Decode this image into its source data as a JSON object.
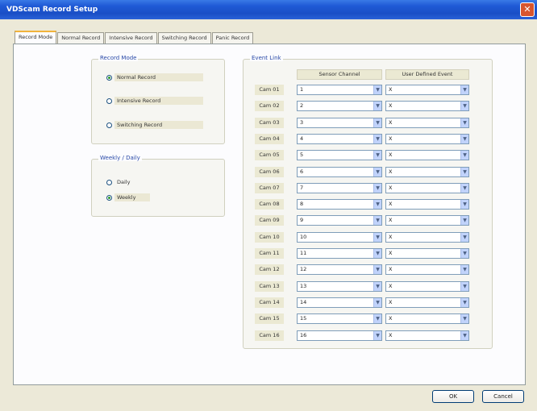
{
  "window": {
    "title": "VDScam Record Setup",
    "close_glyph": "✕"
  },
  "tabs": [
    {
      "label": "Record Mode",
      "active": true
    },
    {
      "label": "Normal Record",
      "active": false
    },
    {
      "label": "Intensive Record",
      "active": false
    },
    {
      "label": "Switching Record",
      "active": false
    },
    {
      "label": "Panic Record",
      "active": false
    }
  ],
  "record_mode": {
    "title": "Record Mode",
    "options": [
      {
        "label": "Normal Record",
        "checked": true
      },
      {
        "label": "Intensive Record",
        "checked": false
      },
      {
        "label": "Switching Record",
        "checked": false
      }
    ]
  },
  "schedule": {
    "title": "Weekly / Daily",
    "options": [
      {
        "label": "Daily",
        "checked": false
      },
      {
        "label": "Weekly",
        "checked": true
      }
    ]
  },
  "event_link": {
    "title": "Event Link",
    "col_sensor": "Sensor Channel",
    "col_user": "User Defined Event",
    "rows": [
      {
        "cam": "Cam 01",
        "sensor": "1",
        "user": "X"
      },
      {
        "cam": "Cam 02",
        "sensor": "2",
        "user": "X"
      },
      {
        "cam": "Cam 03",
        "sensor": "3",
        "user": "X"
      },
      {
        "cam": "Cam 04",
        "sensor": "4",
        "user": "X"
      },
      {
        "cam": "Cam 05",
        "sensor": "5",
        "user": "X"
      },
      {
        "cam": "Cam 06",
        "sensor": "6",
        "user": "X"
      },
      {
        "cam": "Cam 07",
        "sensor": "7",
        "user": "X"
      },
      {
        "cam": "Cam 08",
        "sensor": "8",
        "user": "X"
      },
      {
        "cam": "Cam 09",
        "sensor": "9",
        "user": "X"
      },
      {
        "cam": "Cam 10",
        "sensor": "10",
        "user": "X"
      },
      {
        "cam": "Cam 11",
        "sensor": "11",
        "user": "X"
      },
      {
        "cam": "Cam 12",
        "sensor": "12",
        "user": "X"
      },
      {
        "cam": "Cam 13",
        "sensor": "13",
        "user": "X"
      },
      {
        "cam": "Cam 14",
        "sensor": "14",
        "user": "X"
      },
      {
        "cam": "Cam 15",
        "sensor": "15",
        "user": "X"
      },
      {
        "cam": "Cam 16",
        "sensor": "16",
        "user": "X"
      }
    ]
  },
  "buttons": {
    "ok": "OK",
    "cancel": "Cancel"
  },
  "icons": {
    "dropdown": "chevron-down-icon",
    "close": "close-icon"
  },
  "colors": {
    "titlebar": "#1f5ad6",
    "group_title": "#2a4aa8",
    "dialog_bg": "#ece9d8"
  }
}
